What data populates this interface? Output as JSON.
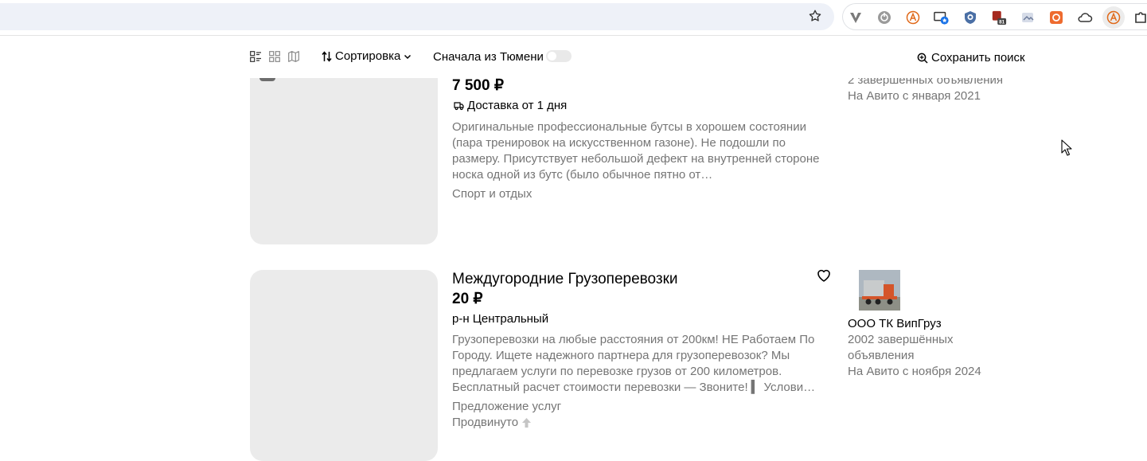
{
  "toolbar": {
    "sort_label": "Сортировка",
    "toggle_label": "Сначала из Тюмени",
    "save_search_label": "Сохранить поиск"
  },
  "listings": [
    {
      "price": "7 500 ₽",
      "delivery": "Доставка от 1 дня",
      "description": "Оригинальные профессиональные бутсы в хорошем состоянии (пара тренировок на искусственном газоне). Не подошли по размеру. Присутствует небольшой дефект на внутренней стороне носка одной из бутс (было обычное пятно от…",
      "category": "Спорт и отдых",
      "seller": {
        "completed": "2 завершенных объявления",
        "since": "На Авито с января 2021"
      }
    },
    {
      "title": "Междугородние Грузоперевозки",
      "price": "20 ₽",
      "location": "р-н Центральный",
      "description": "Грузоперевозки на любые расстояния от 200км! НЕ Работаем По Городу. Ищете надежного партнера для грузоперевозок? Мы предлагаем услуги по перевозке грузов от 200 километров. Бесплатный расчет стоимости перевозки — Звоните! ▍ Услови…",
      "category": "Предложение услуг",
      "promoted": "Продвинуто",
      "seller": {
        "name": "ООО ТК ВипГруз",
        "completed": "2002 завершённых объявления",
        "since": "На Авито с ноября 2024"
      }
    }
  ]
}
